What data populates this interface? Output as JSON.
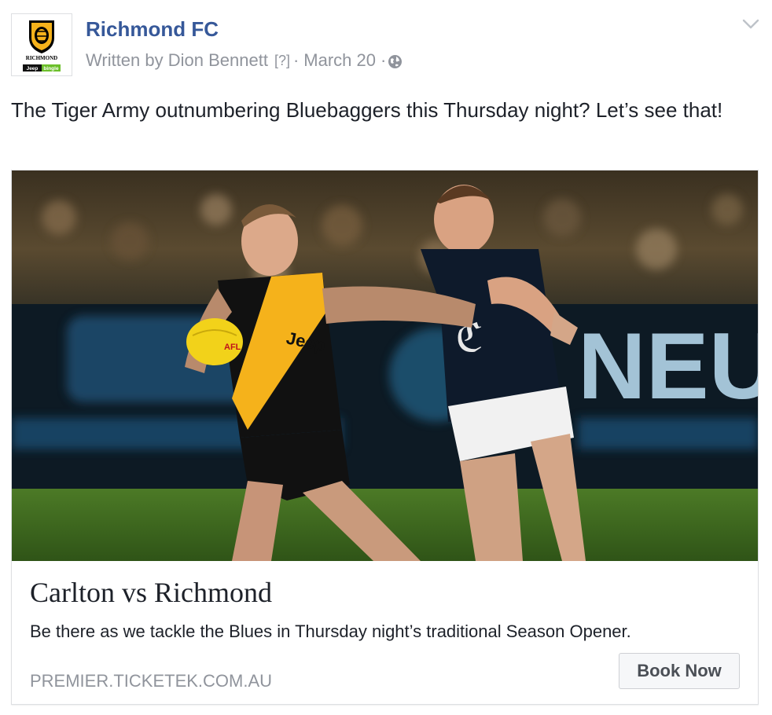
{
  "header": {
    "page_name": "Richmond FC",
    "author_prefix": "Written by Dion Bennett",
    "help_marker": "[?]",
    "separator": "·",
    "date": "March 20"
  },
  "post": {
    "text": "The Tiger Army outnumbering Bluebaggers this Thursday night? Let’s see that!"
  },
  "avatar": {
    "logo_text": "RICHMOND",
    "sponsor_a": "Jeep",
    "sponsor_b": "bingle"
  },
  "card": {
    "title": "Carlton vs Richmond",
    "description": "Be there as we tackle the Blues in Thursday night’s traditional Season Opener.",
    "domain": "PREMIER.TICKETEK.COM.AU",
    "cta_label": "Book Now",
    "photo_signage": "NEU",
    "jersey_sponsor": "Jeep",
    "ball_text": "AFL"
  },
  "icons": {
    "globe": "globe-icon",
    "menu": "chevron-down-icon"
  },
  "colors": {
    "brand_link": "#365899",
    "meta_grey": "#90949c",
    "richmond_yellow": "#f5b21b",
    "carlton_navy": "#0e1a2b",
    "pitch_green": "#3f6a1f"
  }
}
